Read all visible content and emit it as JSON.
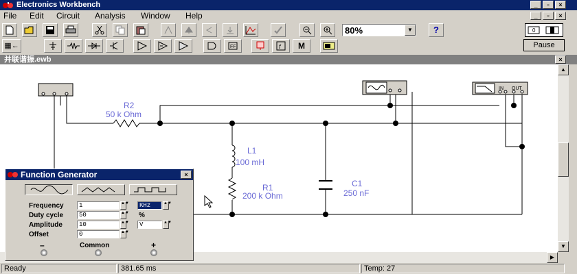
{
  "window": {
    "title": "Electronics Workbench"
  },
  "menu": [
    "File",
    "Edit",
    "Circuit",
    "Analysis",
    "Window",
    "Help"
  ],
  "toolbar": {
    "zoom": "80%",
    "help": "?",
    "pause_label": "Pause"
  },
  "document": {
    "title": "并联谐振.ewb"
  },
  "components": {
    "r2_name": "R2",
    "r2_value": "50 k Ohm",
    "l1_name": "L1",
    "l1_value": "100 mH",
    "r1_name": "R1",
    "r1_value": "200 k Ohm",
    "c1_name": "C1",
    "c1_value": "250 nF",
    "bode_in": "IN",
    "bode_out": "OUT"
  },
  "function_generator": {
    "title": "Function Generator",
    "rows": [
      {
        "label": "Frequency",
        "value": "1",
        "unit": "KHz"
      },
      {
        "label": "Duty cycle",
        "value": "50",
        "unit": "%"
      },
      {
        "label": "Amplitude",
        "value": "10",
        "unit": "V"
      },
      {
        "label": "Offset",
        "value": "0",
        "unit": ""
      }
    ],
    "minus": "–",
    "common": "Common",
    "plus": "+"
  },
  "status": {
    "ready": "Ready",
    "time": "381.65 ms",
    "temp": "Temp:  27"
  }
}
